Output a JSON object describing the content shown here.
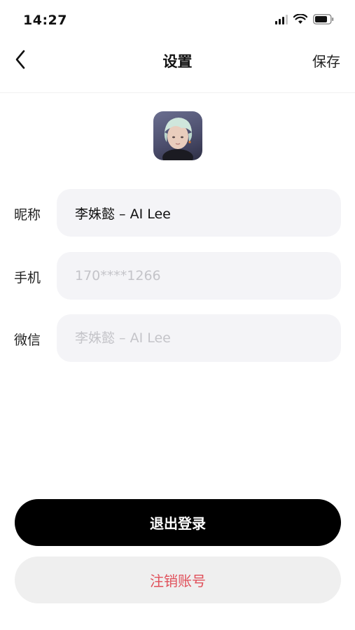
{
  "status_bar": {
    "time": "14:27"
  },
  "nav": {
    "title": "设置",
    "save_label": "保存"
  },
  "form": {
    "nickname": {
      "label": "昵称",
      "value": "李姝懿 – AI Lee"
    },
    "phone": {
      "label": "手机",
      "placeholder": "170****1266"
    },
    "wechat": {
      "label": "微信",
      "placeholder": "李姝懿 – AI Lee"
    }
  },
  "actions": {
    "logout_label": "退出登录",
    "deactivate_label": "注销账号"
  },
  "colors": {
    "primary_button": "#000000",
    "danger_text": "#e0505a",
    "field_background": "#f4f4f7"
  }
}
